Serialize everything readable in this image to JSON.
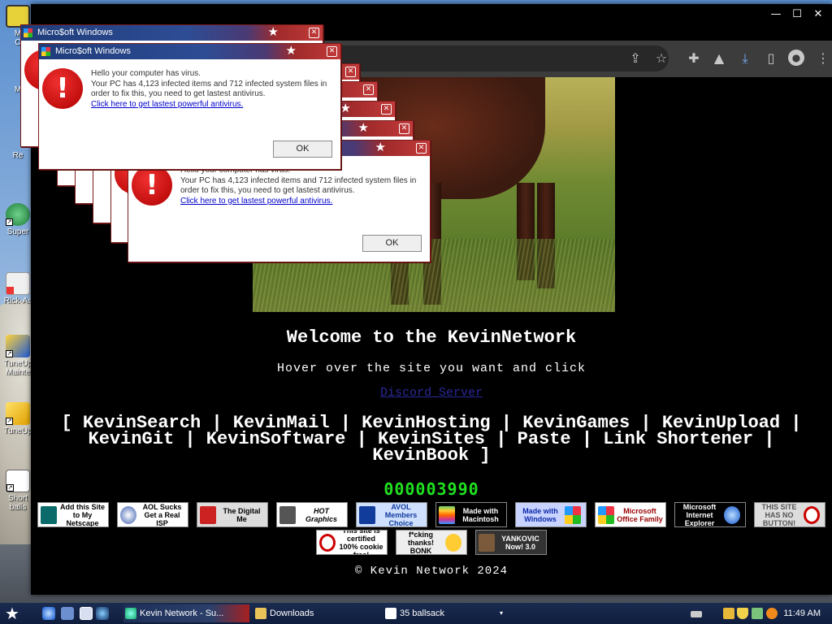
{
  "desktop": {
    "icons": [
      {
        "label": "M\nC",
        "name": "desktop-icon-computer"
      },
      {
        "label": "M",
        "name": "desktop-icon-m"
      },
      {
        "label": "Re",
        "name": "desktop-icon-recycle"
      },
      {
        "label": "Super",
        "name": "desktop-icon-super"
      },
      {
        "label": "Rick-As",
        "name": "desktop-icon-rick"
      },
      {
        "label": "TuneUp\nMainte",
        "name": "desktop-icon-tuneup-maint"
      },
      {
        "label": "TuneUp",
        "name": "desktop-icon-tuneup"
      },
      {
        "label": "Short\nballs",
        "name": "desktop-icon-shortcut"
      }
    ]
  },
  "browser": {
    "controls": {
      "minimize": "—",
      "maximize": "☐",
      "close": "✕"
    },
    "toolbar_icons": [
      "share-icon",
      "star-icon",
      "extensions-icon",
      "labs-icon",
      "download-icon",
      "sidebar-icon",
      "profile-icon",
      "menu-icon"
    ]
  },
  "page": {
    "welcome": "Welcome to the KevinNetwork",
    "hover_text": "Hover over the site you want and click",
    "discord_link": "Discord Server",
    "sites_line1": "[ KevinSearch | KevinMail | KevinHosting | KevinGames | KevinUpload |",
    "sites_line2": "KevinGit | KevinSoftware | KevinSites | Paste | Link Shortener |",
    "sites_line3": "KevinBook ]",
    "counter": "000003990",
    "badges_row1": [
      "Add this Site to My Netscape",
      "AOL Sucks Get a Real ISP",
      "The Digital Me",
      "HOT Graphics",
      "AVOL Members Choice",
      "Made with Macintosh",
      "Made with Windows",
      "Microsoft Office Family",
      "Microsoft Internet Explorer",
      "THIS SITE HAS NO BUTTON!"
    ],
    "badges_row2": [
      "This site is certified 100% cookie free!",
      "f*cking thanks! BONK",
      "YANKOVIC Now! 3.0"
    ],
    "copyright": "© Kevin Network 2024"
  },
  "popup": {
    "title": "Micro$oft Windows",
    "line1": "Hello your computer has virus.",
    "line2": "Your PC has 4,123 infected items and 712 infected system files in order to fix this, you need to get lastest antivirus.",
    "link": "Click here to get lastest powerful antivirus.",
    "ok": "OK",
    "partial_line1": "Hello your computer has virus."
  },
  "taskbar": {
    "tasks": {
      "kevin": "Kevin Network - Su...",
      "downloads": "Downloads",
      "ballsack": "35 ballsack"
    },
    "clock": "11:49 AM"
  },
  "colors": {
    "counter_green": "#20e020",
    "link_blue": "#0000cc",
    "popup_border": "#7a1b1b"
  }
}
